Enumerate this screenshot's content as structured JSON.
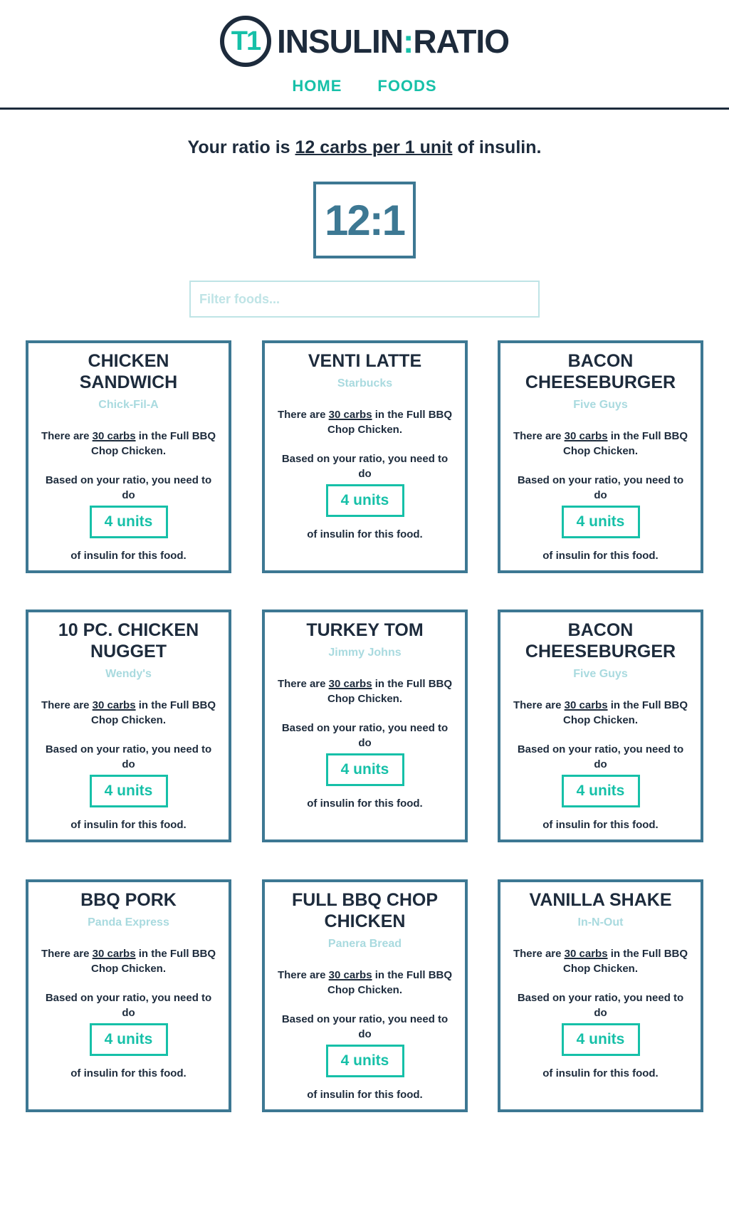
{
  "logo": {
    "badge": "T1",
    "left": "INSULIN",
    "sep": ":",
    "right": "RATIO"
  },
  "nav": {
    "home": "HOME",
    "foods": "FOODS"
  },
  "ratio": {
    "prefix": "Your ratio is ",
    "highlight": "12 carbs per 1 unit",
    "suffix": " of insulin.",
    "display": "12:1"
  },
  "filter": {
    "placeholder": "Filter foods..."
  },
  "card_text": {
    "there_are": "There are ",
    "carbs": "30 carbs",
    "in_the": " in the Full BBQ Chop Chicken.",
    "based": "Based on your ratio, you need to do",
    "units": "4 units",
    "foot": "of insulin for this food."
  },
  "foods": [
    {
      "title": "CHICKEN SANDWICH",
      "brand": "Chick-Fil-A"
    },
    {
      "title": "VENTI LATTE",
      "brand": "Starbucks"
    },
    {
      "title": "BACON CHEESEBURGER",
      "brand": "Five Guys"
    },
    {
      "title": "10 PC. CHICKEN NUGGET",
      "brand": "Wendy's"
    },
    {
      "title": "TURKEY TOM",
      "brand": "Jimmy Johns"
    },
    {
      "title": "BACON CHEESEBURGER",
      "brand": "Five Guys"
    },
    {
      "title": "BBQ PORK",
      "brand": "Panda Express"
    },
    {
      "title": "FULL BBQ CHOP CHICKEN",
      "brand": "Panera Bread"
    },
    {
      "title": "VANILLA SHAKE",
      "brand": "In-N-Out"
    }
  ]
}
